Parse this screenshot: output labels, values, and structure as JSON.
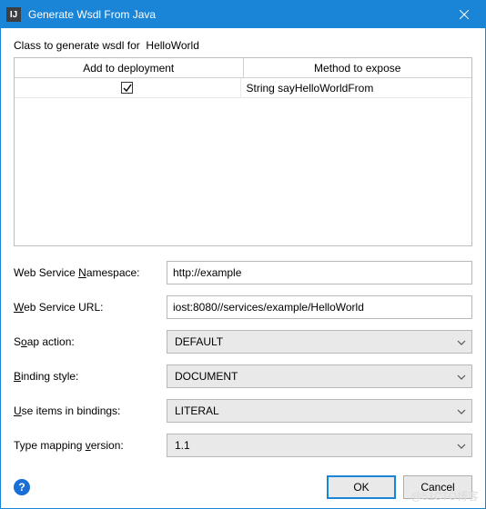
{
  "window": {
    "title": "Generate Wsdl From Java"
  },
  "heading_prefix": "Class to generate wsdl for",
  "heading_class": "HelloWorld",
  "table": {
    "headers": [
      "Add to deployment",
      "Method to expose"
    ],
    "rows": [
      {
        "checked": true,
        "method": "String sayHelloWorldFrom"
      }
    ]
  },
  "fields": {
    "namespace": {
      "label_pre": "Web Service ",
      "label_underline": "N",
      "label_post": "amespace:",
      "value": "http://example"
    },
    "url": {
      "label_pre": "",
      "label_underline": "W",
      "label_post": "eb Service URL:",
      "value": "iost:8080//services/example/HelloWorld"
    },
    "soap": {
      "label_pre": "S",
      "label_underline": "o",
      "label_post": "ap action:",
      "value": "DEFAULT"
    },
    "binding": {
      "label_pre": "",
      "label_underline": "B",
      "label_post": "inding style:",
      "value": "DOCUMENT"
    },
    "useitems": {
      "label_pre": "",
      "label_underline": "U",
      "label_post": "se items in bindings:",
      "value": "LITERAL"
    },
    "typemap": {
      "label_pre": "Type mapping ",
      "label_underline": "v",
      "label_post": "ersion:",
      "value": "1.1"
    }
  },
  "buttons": {
    "ok": "OK",
    "cancel": "Cancel"
  },
  "watermark": "@51CTO博客"
}
